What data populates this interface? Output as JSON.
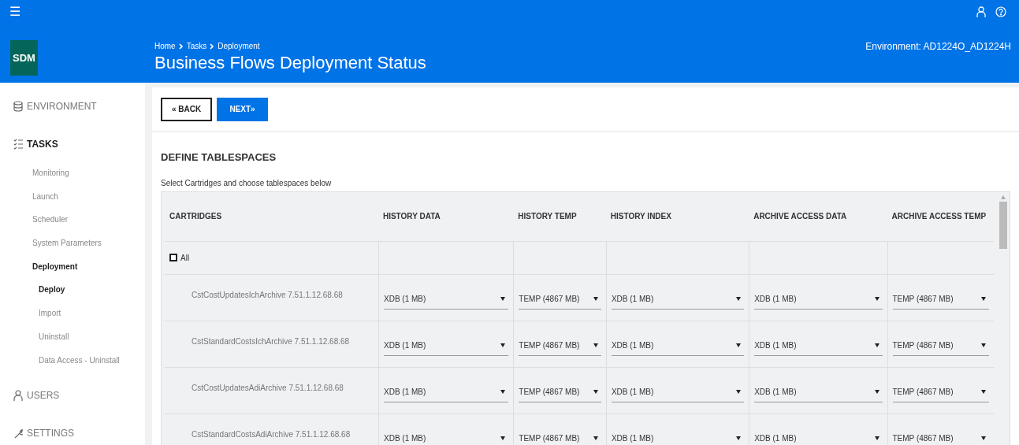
{
  "header": {
    "menu_icon": "☰",
    "logo": "SDM",
    "breadcrumb": [
      "Home",
      "Tasks",
      "Deployment"
    ],
    "title": "Business Flows Deployment Status",
    "environment": "Environment: AD1224O_AD1224H"
  },
  "sidebar": {
    "items": [
      {
        "kind": "environment",
        "label": "ENVIRONMENT",
        "selected": false
      },
      {
        "kind": "tasks",
        "label": "TASKS",
        "selected": true,
        "children": [
          {
            "label": "Monitoring",
            "selected": false
          },
          {
            "label": "Launch",
            "selected": false
          },
          {
            "label": "Scheduler",
            "selected": false
          },
          {
            "label": "System Parameters",
            "selected": false
          },
          {
            "label": "Deployment",
            "selected": true,
            "children": [
              {
                "label": "Deploy",
                "selected": true
              },
              {
                "label": "Import",
                "selected": false
              },
              {
                "label": "Uninstall",
                "selected": false
              },
              {
                "label": "Data Access - Uninstall",
                "selected": false
              }
            ]
          }
        ]
      },
      {
        "kind": "users",
        "label": "USERS",
        "selected": false
      },
      {
        "kind": "settings",
        "label": "SETTINGS",
        "selected": false
      }
    ]
  },
  "buttons": {
    "back": "« BACK",
    "next": "NEXT»"
  },
  "section": {
    "title": "DEFINE TABLESPACES",
    "subtitle": "Select Cartridges and choose tablespaces below"
  },
  "table": {
    "columns": [
      "CARTRIDGES",
      "HISTORY DATA",
      "HISTORY TEMP",
      "HISTORY INDEX",
      "ARCHIVE ACCESS DATA",
      "ARCHIVE ACCESS TEMP"
    ],
    "select_all": {
      "label": "All",
      "checked": false
    },
    "rows": [
      {
        "cartridge": "CstCostUpdatesIchArchive 7.51.1.12.68.68",
        "values": [
          "XDB (1 MB)",
          "TEMP (4867 MB)",
          "XDB (1 MB)",
          "XDB (1 MB)",
          "TEMP (4867 MB)"
        ]
      },
      {
        "cartridge": "CstStandardCostsIchArchive 7.51.1.12.68.68",
        "values": [
          "XDB (1 MB)",
          "TEMP (4867 MB)",
          "XDB (1 MB)",
          "XDB (1 MB)",
          "TEMP (4867 MB)"
        ]
      },
      {
        "cartridge": "CstCostUpdatesAdiArchive 7.51.1.12.68.68",
        "values": [
          "XDB (1 MB)",
          "TEMP (4867 MB)",
          "XDB (1 MB)",
          "XDB (1 MB)",
          "TEMP (4867 MB)"
        ]
      },
      {
        "cartridge": "CstStandardCostsAdiArchive 7.51.1.12.68.68",
        "values": [
          "XDB (1 MB)",
          "TEMP (4867 MB)",
          "XDB (1 MB)",
          "XDB (1 MB)",
          "TEMP (4867 MB)"
        ]
      }
    ]
  }
}
